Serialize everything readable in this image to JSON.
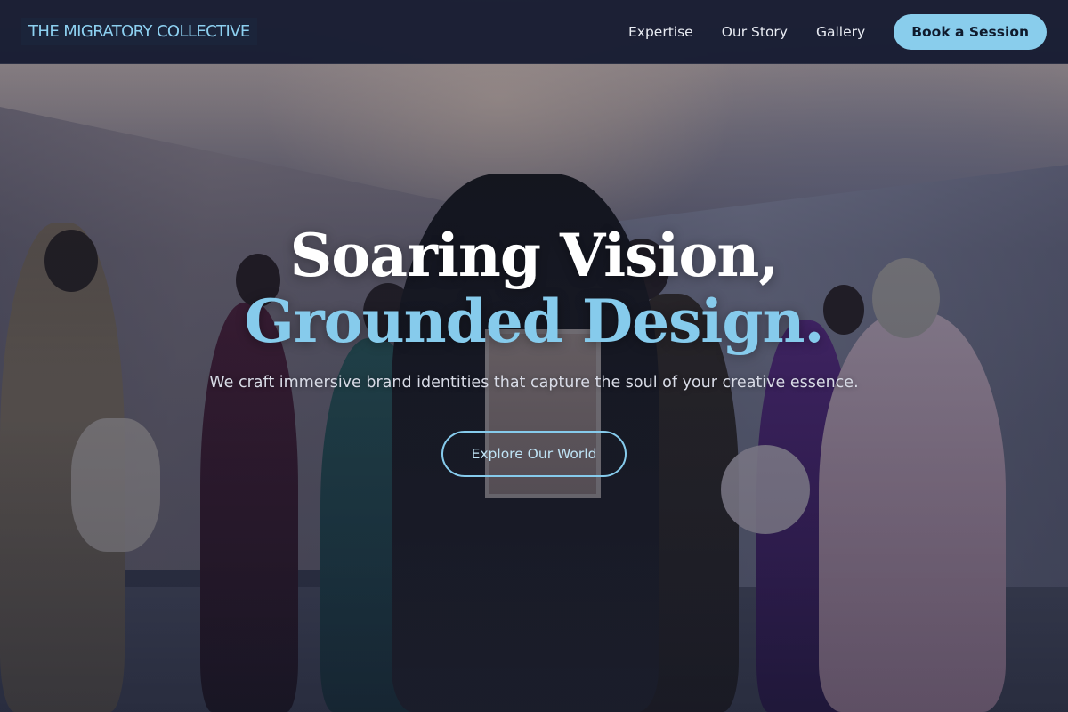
{
  "header": {
    "brand": "THE MIGRATORY COLLECTIVE",
    "nav": [
      {
        "label": "Expertise"
      },
      {
        "label": "Our Story"
      },
      {
        "label": "Gallery"
      }
    ],
    "cta_label": "Book a Session"
  },
  "hero": {
    "headline_line_1": "Soaring Vision,",
    "headline_line_2": "Grounded Design.",
    "subheadline": "We craft immersive brand identities that capture the soul of your creative essence.",
    "cta_label": "Explore Our World",
    "background_image": "fashion-group-photo"
  },
  "colors": {
    "accent": "#89cdec",
    "nav_background": "#141a30",
    "headline_primary": "#ffffff",
    "headline_accent": "#86cbec"
  }
}
